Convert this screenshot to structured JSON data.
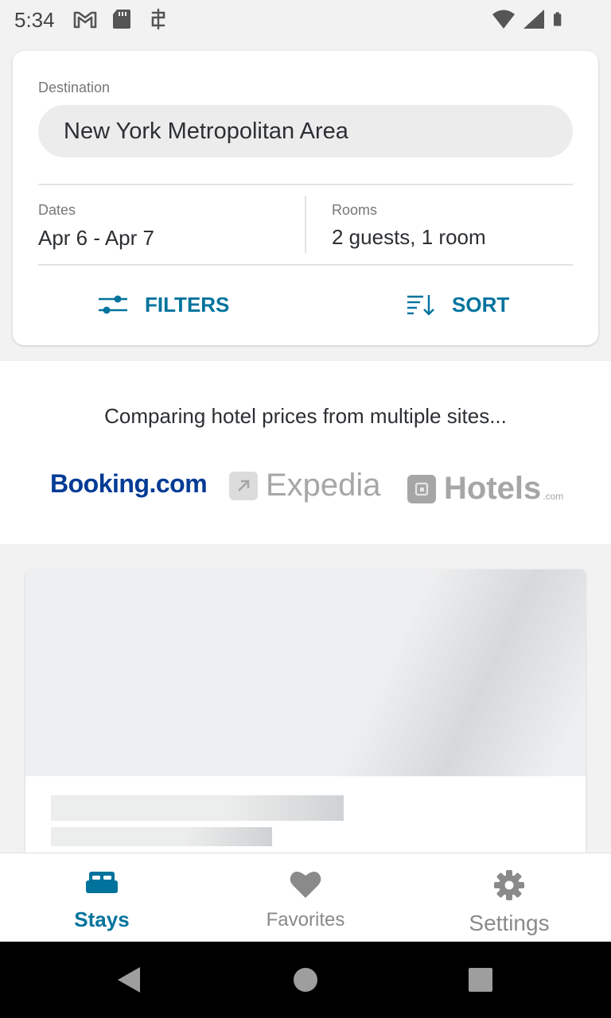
{
  "status_bar": {
    "time": "5:34",
    "left_icons": [
      "gmail-icon",
      "sd-card-icon",
      "sync-icon"
    ],
    "right_icons": [
      "wifi-icon",
      "signal-icon",
      "battery-icon"
    ]
  },
  "search": {
    "destination_label": "Destination",
    "destination_value": "New York Metropolitan Area",
    "dates_label": "Dates",
    "dates_value": "Apr 6 - Apr 7",
    "rooms_label": "Rooms",
    "rooms_value": "2 guests, 1 room",
    "filters_label": "FILTERS",
    "sort_label": "SORT",
    "accent_color": "#00739d"
  },
  "compare": {
    "text": "Comparing hotel prices from multiple sites...",
    "logos": {
      "booking": "Booking.com",
      "expedia": "Expedia",
      "hotels": "Hotels",
      "hotels_suffix": ".com"
    }
  },
  "bottom_nav": {
    "items": [
      {
        "label": "Stays",
        "icon": "bed-icon",
        "active": true
      },
      {
        "label": "Favorites",
        "icon": "heart-icon",
        "active": false
      },
      {
        "label": "Settings",
        "icon": "gear-icon",
        "active": false
      }
    ]
  },
  "system_nav": {
    "buttons": [
      "back-icon",
      "home-icon",
      "recents-icon"
    ]
  }
}
